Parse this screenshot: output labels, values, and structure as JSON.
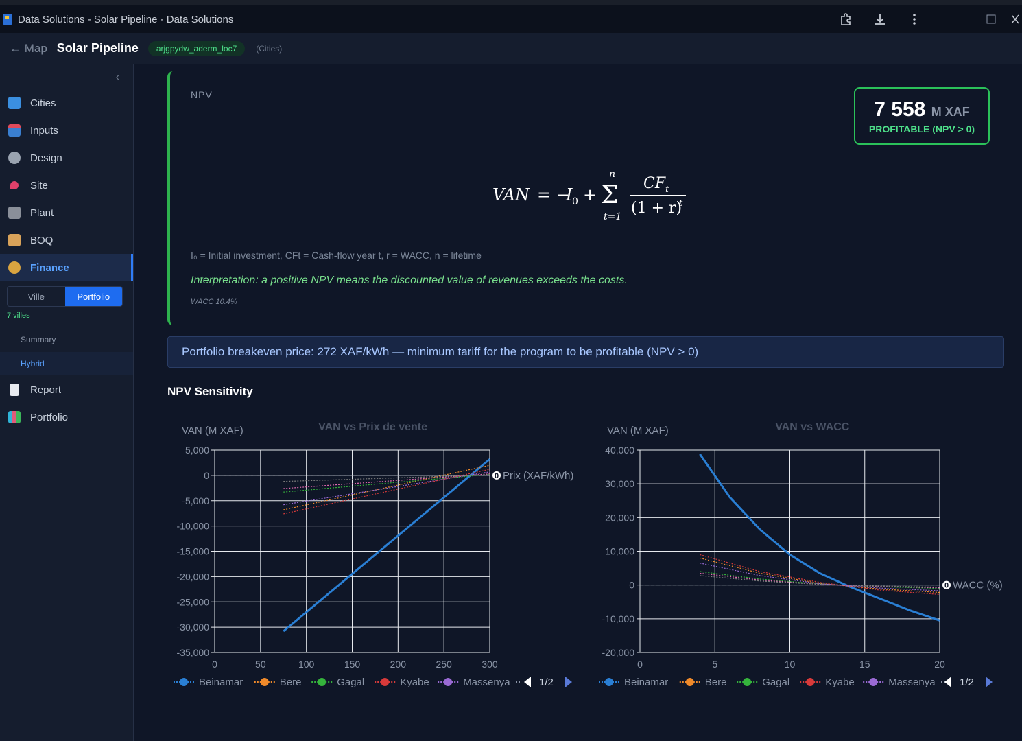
{
  "window": {
    "title": "Data Solutions - Solar Pipeline - Data Solutions",
    "buttons": [
      "extension-icon",
      "download-icon",
      "menu-icon",
      "minimize-icon",
      "maximize-icon"
    ]
  },
  "header": {
    "back": "← Map",
    "project": "Solar Pipeline",
    "location": "arjgpydw_aderm_loc7",
    "location_type": "(Cities)"
  },
  "sidebar": {
    "items": [
      {
        "label": "Cities",
        "icon": "cities-icon"
      },
      {
        "label": "Inputs",
        "icon": "inputs-icon"
      },
      {
        "label": "Design",
        "icon": "gear-icon"
      },
      {
        "label": "Site",
        "icon": "pin-icon"
      },
      {
        "label": "Plant",
        "icon": "factory-icon"
      },
      {
        "label": "BOQ",
        "icon": "clipboard-icon"
      },
      {
        "label": "Finance",
        "icon": "money-bag-icon",
        "active": true
      }
    ],
    "toggle": {
      "left": "Ville",
      "right": "Portfolio",
      "selected": "Portfolio"
    },
    "villes_count": "7 villes",
    "subitems": [
      {
        "label": "Summary"
      },
      {
        "label": "Hybrid",
        "active": true
      }
    ],
    "bottom_items": [
      {
        "label": "Report",
        "icon": "document-icon"
      },
      {
        "label": "Portfolio",
        "icon": "chart-icon"
      }
    ]
  },
  "npv": {
    "label": "NPV",
    "value": "7 558",
    "unit": "M XAF",
    "status": "PROFITABLE (NPV > 0)",
    "legend": "I₀ = Initial investment, CFt = Cash-flow year t, r = WACC, n = lifetime",
    "interpretation": "Interpretation: a positive NPV means the discounted value of revenues exceeds the costs.",
    "wacc": "WACC 10.4%"
  },
  "breakeven": "Portfolio breakeven price: 272 XAF/kWh — minimum tariff for the program to be profitable (NPV > 0)",
  "sensitivity_title": "NPV Sensitivity",
  "colors": {
    "blue": "#2a7fd4",
    "orange": "#f08a2a",
    "green": "#35b43c",
    "red": "#d83a3a",
    "purple": "#9a6ad4",
    "pink": "#e06ab0"
  },
  "chart_data": [
    {
      "type": "line",
      "title": "VAN vs Prix de vente",
      "ylabel": "VAN (M XAF)",
      "xlabel": "Prix (XAF/kWh)",
      "xlim": [
        0,
        300
      ],
      "ylim": [
        -35000,
        5000
      ],
      "xticks": [
        0,
        50,
        100,
        150,
        200,
        250,
        300
      ],
      "yticks": [
        5000,
        0,
        -5000,
        -10000,
        -15000,
        -20000,
        -25000,
        -30000,
        -35000
      ],
      "series": [
        {
          "name": "Beinamar",
          "color": "#2a7fd4",
          "x": [
            75,
            300
          ],
          "y": [
            -30800,
            3200
          ]
        },
        {
          "name": "Bere",
          "color": "#f08a2a",
          "x": [
            75,
            300
          ],
          "y": [
            -6800,
            2000
          ]
        },
        {
          "name": "Gagal",
          "color": "#35b43c",
          "x": [
            75,
            300
          ],
          "y": [
            -3300,
            200
          ]
        },
        {
          "name": "Kyabe",
          "color": "#d83a3a",
          "x": [
            75,
            300
          ],
          "y": [
            -7600,
            1200
          ]
        },
        {
          "name": "Massenya",
          "color": "#9a6ad4",
          "x": [
            75,
            300
          ],
          "y": [
            -5800,
            700
          ]
        },
        {
          "name": "",
          "color": "#e06ab0",
          "x": [
            75,
            300
          ],
          "y": [
            -2600,
            300
          ]
        },
        {
          "name": "",
          "color": "#7f7f7f",
          "x": [
            75,
            300
          ],
          "y": [
            -1200,
            100
          ]
        }
      ],
      "legend": {
        "items": [
          "Beinamar",
          "Bere",
          "Gagal",
          "Kyabe",
          "Massenya"
        ],
        "page": "1/2"
      }
    },
    {
      "type": "line",
      "title": "VAN vs WACC",
      "ylabel": "VAN (M XAF)",
      "xlabel": "WACC (%)",
      "xlim": [
        0,
        20
      ],
      "ylim": [
        -20000,
        40000
      ],
      "xticks": [
        0,
        5,
        10,
        15,
        20
      ],
      "yticks": [
        40000,
        30000,
        20000,
        10000,
        0,
        -10000,
        -20000
      ],
      "series": [
        {
          "name": "Beinamar",
          "color": "#2a7fd4",
          "x": [
            4,
            6,
            8,
            10,
            12,
            14,
            16,
            18,
            20
          ],
          "y": [
            38800,
            26000,
            16500,
            9000,
            3500,
            -500,
            -4000,
            -7500,
            -10500
          ]
        },
        {
          "name": "Bere",
          "color": "#f08a2a",
          "x": [
            4,
            8,
            12,
            16,
            20
          ],
          "y": [
            8000,
            3500,
            500,
            -1200,
            -2200
          ]
        },
        {
          "name": "Gagal",
          "color": "#35b43c",
          "x": [
            4,
            8,
            12,
            16,
            20
          ],
          "y": [
            4000,
            1800,
            300,
            -500,
            -1000
          ]
        },
        {
          "name": "Kyabe",
          "color": "#d83a3a",
          "x": [
            4,
            8,
            12,
            16,
            20
          ],
          "y": [
            9000,
            4000,
            800,
            -1500,
            -2800
          ]
        },
        {
          "name": "Massenya",
          "color": "#9a6ad4",
          "x": [
            4,
            8,
            12,
            16,
            20
          ],
          "y": [
            6500,
            2800,
            400,
            -900,
            -1700
          ]
        },
        {
          "name": "",
          "color": "#e06ab0",
          "x": [
            4,
            8,
            12,
            16,
            20
          ],
          "y": [
            3500,
            1500,
            200,
            -400,
            -800
          ]
        },
        {
          "name": "",
          "color": "#7f7f7f",
          "x": [
            4,
            8,
            12,
            16,
            20
          ],
          "y": [
            2800,
            1200,
            200,
            -300,
            -600
          ]
        }
      ],
      "legend": {
        "items": [
          "Beinamar",
          "Bere",
          "Gagal",
          "Kyabe",
          "Massenya"
        ],
        "page": "1/2"
      }
    }
  ]
}
